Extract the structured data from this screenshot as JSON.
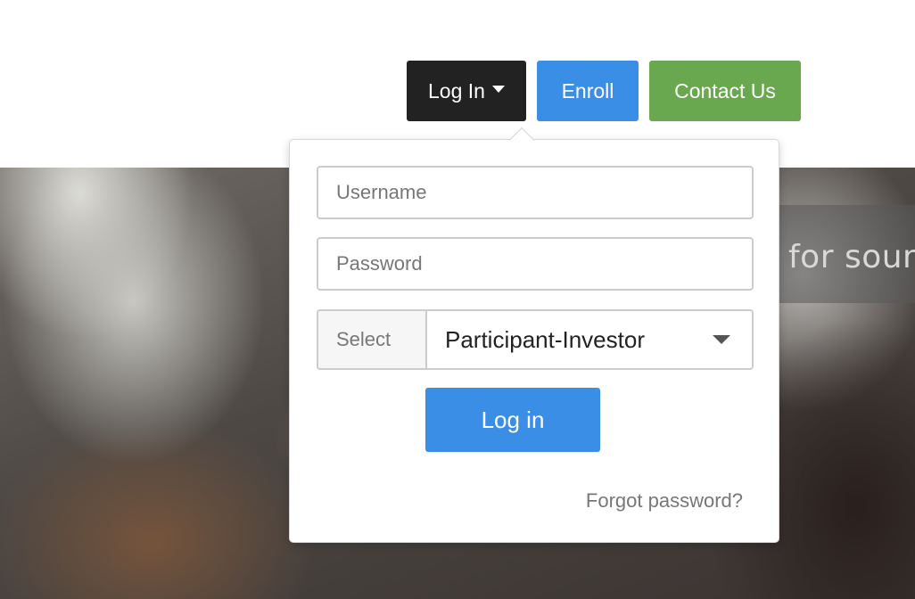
{
  "header": {
    "login_label": "Log In",
    "enroll_label": "Enroll",
    "contact_label": "Contact Us",
    "colors": {
      "login_bg": "#222222",
      "enroll_bg": "#3a8ee6",
      "contact_bg": "#6aa84f"
    }
  },
  "hero": {
    "banner_text": "for soun"
  },
  "login_panel": {
    "username_placeholder": "Username",
    "password_placeholder": "Password",
    "role_addon_label": "Select",
    "role_selected": "Participant-Investor",
    "submit_label": "Log in",
    "forgot_label": "Forgot password?"
  },
  "icons": {
    "login_caret": "caret-down-icon",
    "role_caret": "dropdown-caret-icon"
  }
}
